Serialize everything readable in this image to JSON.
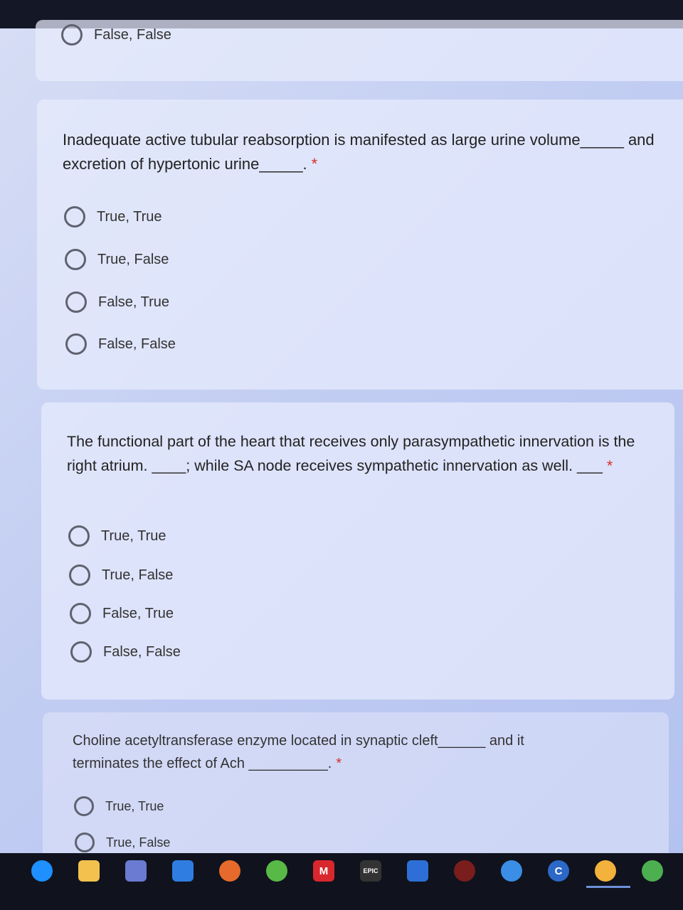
{
  "partial_question": {
    "option_label": "False, False"
  },
  "questions": [
    {
      "text": "Inadequate active tubular reabsorption is manifested as large urine volume_____ and excretion of hypertonic urine_____.",
      "required_mark": "*",
      "options": [
        "True, True",
        "True, False",
        "False, True",
        "False, False"
      ]
    },
    {
      "text": "The functional part of the heart that receives only parasympathetic innervation is the right atrium. ____; while SA node receives sympathetic innervation as well. ___",
      "required_mark": "*",
      "options": [
        "True, True",
        "True, False",
        "False, True",
        "False, False"
      ]
    },
    {
      "text": "Choline acetyltransferase enzyme located in synaptic cleft______ and it terminates the effect of Ach __________.",
      "required_mark": "*",
      "options": [
        "True, True",
        "True, False"
      ]
    }
  ],
  "taskbar": {
    "icons": [
      {
        "name": "edge-icon",
        "color": "#1e90ff"
      },
      {
        "name": "file-explorer-icon",
        "color": "#f2c14e"
      },
      {
        "name": "store-icon",
        "color": "#6a7bd1"
      },
      {
        "name": "mail-icon",
        "color": "#2f7de1"
      },
      {
        "name": "firefox-icon",
        "color": "#e66a2c"
      },
      {
        "name": "utorrent-icon",
        "color": "#58b947"
      },
      {
        "name": "mega-icon",
        "color": "#d9272e",
        "glyph": "M"
      },
      {
        "name": "epic-games-icon",
        "color": "#333333",
        "glyph": "EPIC"
      },
      {
        "name": "shield-icon",
        "color": "#2d6fd6"
      },
      {
        "name": "rog-icon",
        "color": "#7a1d1d"
      },
      {
        "name": "app-icon",
        "color": "#3a8ee6"
      },
      {
        "name": "ccleaner-icon",
        "color": "#2b68c7",
        "glyph": "C"
      },
      {
        "name": "chrome-canary-icon",
        "color": "#f3b23c"
      },
      {
        "name": "chrome-icon",
        "color": "#4caf50"
      }
    ]
  }
}
